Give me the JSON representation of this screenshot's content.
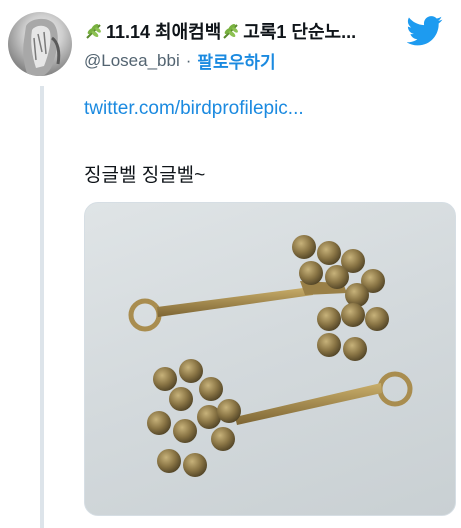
{
  "tweet": {
    "author": {
      "display_name": "11.14 최애컴백",
      "display_name_tail": "고록1 단순노...",
      "handle": "@Losea_bbi",
      "separator": "·",
      "follow_label": "팔로우하기",
      "avatar_icon": "avatar-image",
      "name_emoji_icon": "herb-icon"
    },
    "link_text": "twitter.com/birdprofilepic...",
    "text": "징글벨 징글벨~",
    "media": {
      "kind": "photo",
      "subject_icon": "jingle-bells-photo"
    },
    "brand_icon": "twitter-bird-icon",
    "colors": {
      "link": "#1b8ae0",
      "brand": "#1d9bf0",
      "text": "#0f1419",
      "muted": "#536471"
    }
  }
}
